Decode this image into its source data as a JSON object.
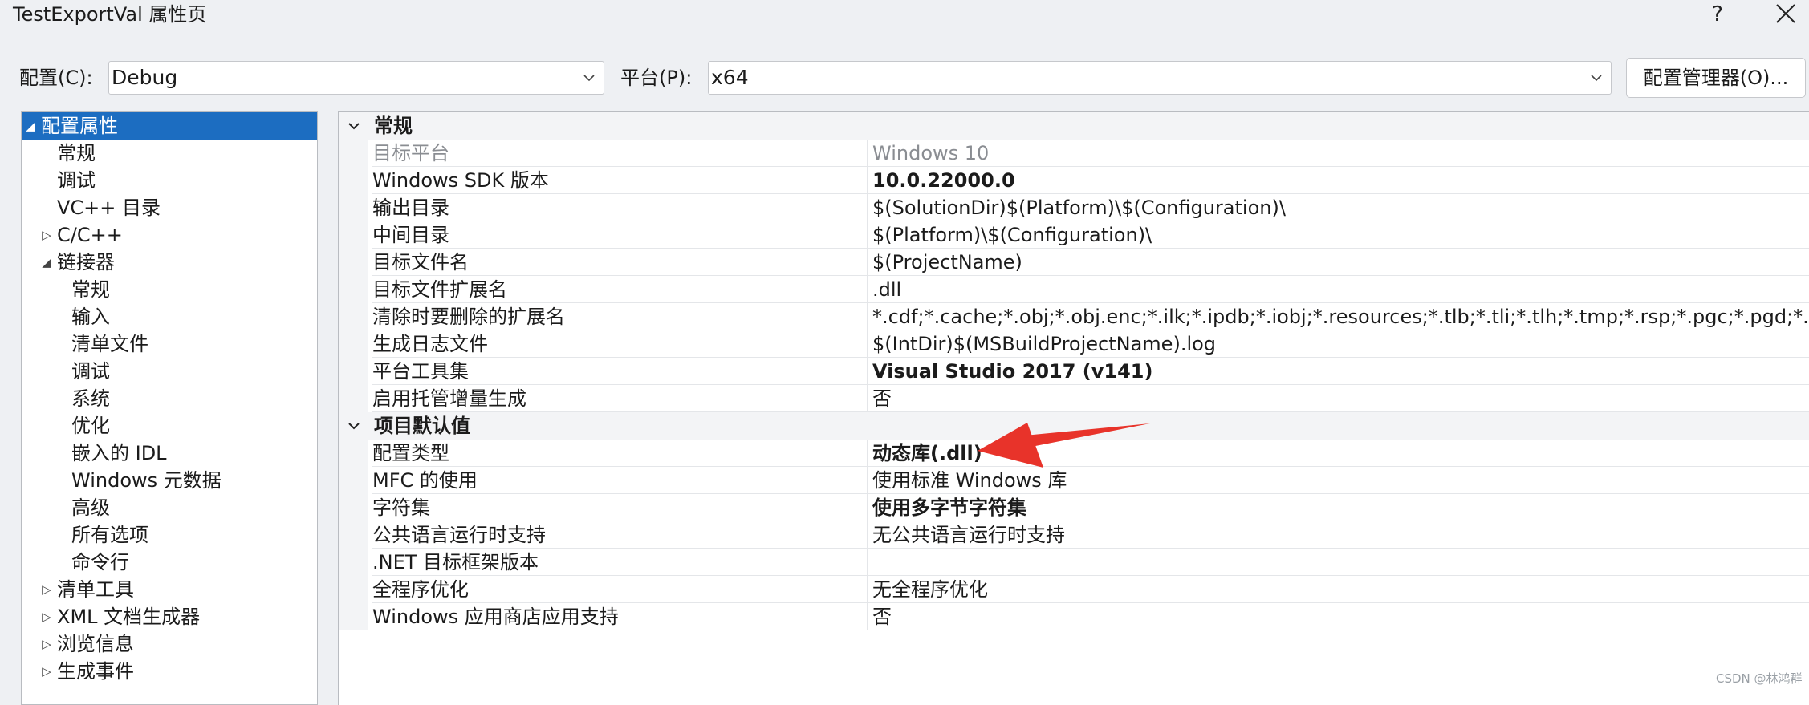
{
  "window": {
    "title": "TestExportVal 属性页",
    "help_label": "?"
  },
  "toolbar": {
    "config_label": "配置(C):",
    "config_value": "Debug",
    "platform_label": "平台(P):",
    "platform_value": "x64",
    "manager_button": "配置管理器(O)..."
  },
  "tree": {
    "items": [
      {
        "label": "配置属性",
        "expander": "◢",
        "selected": true
      },
      {
        "label": "常规"
      },
      {
        "label": "调试"
      },
      {
        "label": "VC++ 目录"
      },
      {
        "label": "C/C++",
        "expander": "▷"
      },
      {
        "label": "链接器",
        "expander": "◢"
      },
      {
        "label": "常规"
      },
      {
        "label": "输入"
      },
      {
        "label": "清单文件"
      },
      {
        "label": "调试"
      },
      {
        "label": "系统"
      },
      {
        "label": "优化"
      },
      {
        "label": "嵌入的 IDL"
      },
      {
        "label": "Windows 元数据"
      },
      {
        "label": "高级"
      },
      {
        "label": "所有选项"
      },
      {
        "label": "命令行"
      },
      {
        "label": "清单工具",
        "expander": "▷"
      },
      {
        "label": "XML 文档生成器",
        "expander": "▷"
      },
      {
        "label": "浏览信息",
        "expander": "▷"
      },
      {
        "label": "生成事件",
        "expander": "▷"
      }
    ]
  },
  "grid": {
    "sections": [
      {
        "title": "常规",
        "rows": [
          {
            "name": "目标平台",
            "value": "Windows 10",
            "disabled": true
          },
          {
            "name": "Windows SDK 版本",
            "value": "10.0.22000.0",
            "bold": true
          },
          {
            "name": "输出目录",
            "value": "$(SolutionDir)$(Platform)\\$(Configuration)\\"
          },
          {
            "name": "中间目录",
            "value": "$(Platform)\\$(Configuration)\\"
          },
          {
            "name": "目标文件名",
            "value": "$(ProjectName)"
          },
          {
            "name": "目标文件扩展名",
            "value": ".dll"
          },
          {
            "name": "清除时要删除的扩展名",
            "value": "*.cdf;*.cache;*.obj;*.obj.enc;*.ilk;*.ipdb;*.iobj;*.resources;*.tlb;*.tli;*.tlh;*.tmp;*.rsp;*.pgc;*.pgd;*.meta;*.tlog;*.manifest;*.res;*.pch;*.exp;*.idb;*.rep;*.xdc;*.pdb"
          },
          {
            "name": "生成日志文件",
            "value": "$(IntDir)$(MSBuildProjectName).log"
          },
          {
            "name": "平台工具集",
            "value": "Visual Studio 2017 (v141)",
            "bold": true
          },
          {
            "name": "启用托管增量生成",
            "value": "否"
          }
        ]
      },
      {
        "title": "项目默认值",
        "rows": [
          {
            "name": "配置类型",
            "value": "动态库(.dll)",
            "bold": true
          },
          {
            "name": "MFC 的使用",
            "value": "使用标准 Windows 库"
          },
          {
            "name": "字符集",
            "value": "使用多字节字符集",
            "bold": true
          },
          {
            "name": "公共语言运行时支持",
            "value": "无公共语言运行时支持"
          },
          {
            "name": ".NET 目标框架版本",
            "value": ""
          },
          {
            "name": "全程序优化",
            "value": "无全程序优化"
          },
          {
            "name": "Windows 应用商店应用支持",
            "value": "否"
          }
        ]
      }
    ]
  },
  "annotation": {
    "arrow_color": "#e8332a"
  },
  "watermark": "CSDN @林鸿群"
}
